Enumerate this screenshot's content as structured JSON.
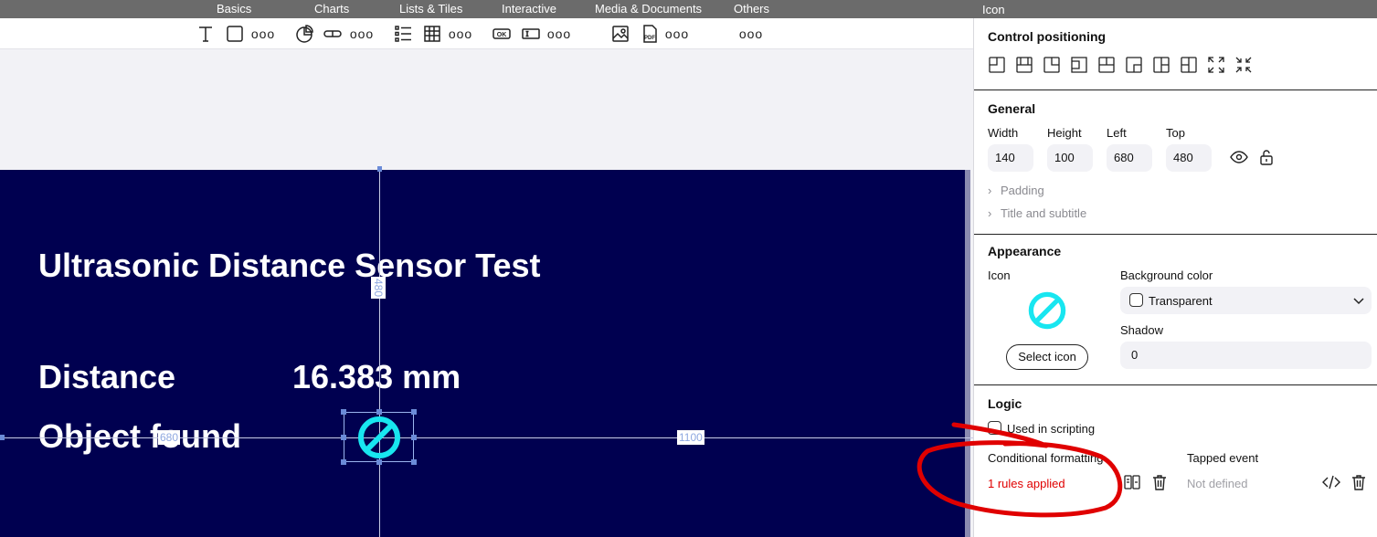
{
  "categories": [
    "Basics",
    "Charts",
    "Lists & Tiles",
    "Interactive",
    "Media & Documents",
    "Others"
  ],
  "panel_header": "Icon",
  "toolbar": {
    "more_label": "ooo",
    "icons": [
      "text-icon",
      "rectangle-icon",
      "pie-chart-icon",
      "slider-icon",
      "list-icon",
      "table-icon",
      "ok-button-icon",
      "text-input-icon",
      "image-icon",
      "pdf-icon"
    ]
  },
  "screen": {
    "title": "Ultrasonic Distance Sensor Test",
    "distance_label": "Distance",
    "distance_value": "16.383 mm",
    "object_label": "Object found",
    "background_color": "#000050",
    "icon_color": "#18e6f0"
  },
  "guides": {
    "top_value": "480",
    "left_value": "680",
    "right_value": "1100"
  },
  "panel": {
    "control_positioning": "Control positioning",
    "general": {
      "title": "General",
      "width_label": "Width",
      "width_value": "140",
      "height_label": "Height",
      "height_value": "100",
      "left_label": "Left",
      "left_value": "680",
      "top_label": "Top",
      "top_value": "480",
      "padding_label": "Padding",
      "title_subtitle_label": "Title and subtitle"
    },
    "appearance": {
      "title": "Appearance",
      "icon_label": "Icon",
      "select_icon_label": "Select icon",
      "background_color_label": "Background color",
      "background_color_value": "Transparent",
      "shadow_label": "Shadow",
      "shadow_value": "0"
    },
    "logic": {
      "title": "Logic",
      "used_in_scripting": "Used in scripting",
      "conditional_formatting": "Conditional formatting",
      "rules_applied": "1 rules applied",
      "tapped_event": "Tapped event",
      "not_defined": "Not defined"
    }
  },
  "annotation_color": "#e00000"
}
